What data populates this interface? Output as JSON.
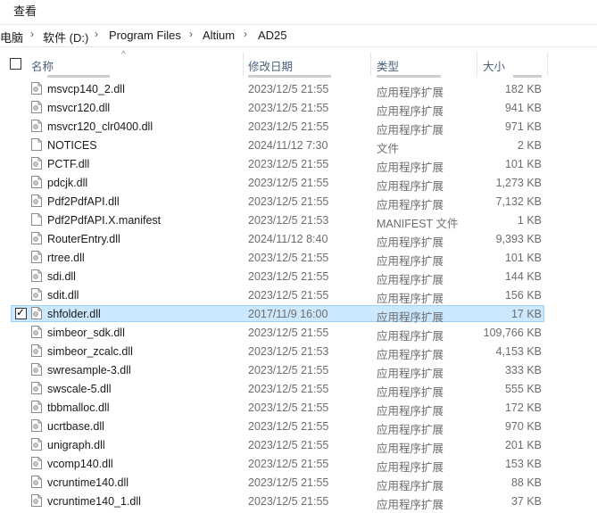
{
  "menu": {
    "view_label": "查看"
  },
  "breadcrumb": {
    "items": [
      "电脑",
      "软件 (D:)",
      "Program Files",
      "Altium",
      "AD25"
    ]
  },
  "columns": {
    "name": "名称",
    "date": "修改日期",
    "type": "类型",
    "size": "大小"
  },
  "files": [
    {
      "name": "msvcp140_2.dll",
      "date": "2023/12/5 21:55",
      "type": "应用程序扩展",
      "size": "182 KB",
      "icon": "dll-file-icon"
    },
    {
      "name": "msvcr120.dll",
      "date": "2023/12/5 21:55",
      "type": "应用程序扩展",
      "size": "941 KB",
      "icon": "dll-file-icon"
    },
    {
      "name": "msvcr120_clr0400.dll",
      "date": "2023/12/5 21:55",
      "type": "应用程序扩展",
      "size": "971 KB",
      "icon": "dll-file-icon"
    },
    {
      "name": "NOTICES",
      "date": "2024/11/12 7:30",
      "type": "文件",
      "size": "2 KB",
      "icon": "blank-file-icon"
    },
    {
      "name": "PCTF.dll",
      "date": "2023/12/5 21:55",
      "type": "应用程序扩展",
      "size": "101 KB",
      "icon": "dll-file-icon"
    },
    {
      "name": "pdcjk.dll",
      "date": "2023/12/5 21:55",
      "type": "应用程序扩展",
      "size": "1,273 KB",
      "icon": "dll-file-icon"
    },
    {
      "name": "Pdf2PdfAPI.dll",
      "date": "2023/12/5 21:55",
      "type": "应用程序扩展",
      "size": "7,132 KB",
      "icon": "dll-file-icon"
    },
    {
      "name": "Pdf2PdfAPI.X.manifest",
      "date": "2023/12/5 21:53",
      "type": "MANIFEST 文件",
      "size": "1 KB",
      "icon": "blank-file-icon"
    },
    {
      "name": "RouterEntry.dll",
      "date": "2024/11/12 8:40",
      "type": "应用程序扩展",
      "size": "9,393 KB",
      "icon": "dll-file-icon"
    },
    {
      "name": "rtree.dll",
      "date": "2023/12/5 21:55",
      "type": "应用程序扩展",
      "size": "101 KB",
      "icon": "dll-file-icon"
    },
    {
      "name": "sdi.dll",
      "date": "2023/12/5 21:55",
      "type": "应用程序扩展",
      "size": "144 KB",
      "icon": "dll-file-icon"
    },
    {
      "name": "sdit.dll",
      "date": "2023/12/5 21:55",
      "type": "应用程序扩展",
      "size": "156 KB",
      "icon": "dll-file-icon"
    },
    {
      "name": "shfolder.dll",
      "date": "2017/11/9 16:00",
      "type": "应用程序扩展",
      "size": "17 KB",
      "icon": "dll-file-icon",
      "selected": true
    },
    {
      "name": "simbeor_sdk.dll",
      "date": "2023/12/5 21:55",
      "type": "应用程序扩展",
      "size": "109,766 KB",
      "icon": "dll-file-icon"
    },
    {
      "name": "simbeor_zcalc.dll",
      "date": "2023/12/5 21:53",
      "type": "应用程序扩展",
      "size": "4,153 KB",
      "icon": "dll-file-icon"
    },
    {
      "name": "swresample-3.dll",
      "date": "2023/12/5 21:55",
      "type": "应用程序扩展",
      "size": "333 KB",
      "icon": "dll-file-icon"
    },
    {
      "name": "swscale-5.dll",
      "date": "2023/12/5 21:55",
      "type": "应用程序扩展",
      "size": "555 KB",
      "icon": "dll-file-icon"
    },
    {
      "name": "tbbmalloc.dll",
      "date": "2023/12/5 21:55",
      "type": "应用程序扩展",
      "size": "172 KB",
      "icon": "dll-file-icon"
    },
    {
      "name": "ucrtbase.dll",
      "date": "2023/12/5 21:55",
      "type": "应用程序扩展",
      "size": "970 KB",
      "icon": "dll-file-icon"
    },
    {
      "name": "unigraph.dll",
      "date": "2023/12/5 21:55",
      "type": "应用程序扩展",
      "size": "201 KB",
      "icon": "dll-file-icon"
    },
    {
      "name": "vcomp140.dll",
      "date": "2023/12/5 21:55",
      "type": "应用程序扩展",
      "size": "153 KB",
      "icon": "dll-file-icon"
    },
    {
      "name": "vcruntime140.dll",
      "date": "2023/12/5 21:55",
      "type": "应用程序扩展",
      "size": "88 KB",
      "icon": "dll-file-icon"
    },
    {
      "name": "vcruntime140_1.dll",
      "date": "2023/12/5 21:55",
      "type": "应用程序扩展",
      "size": "37 KB",
      "icon": "dll-file-icon"
    }
  ]
}
